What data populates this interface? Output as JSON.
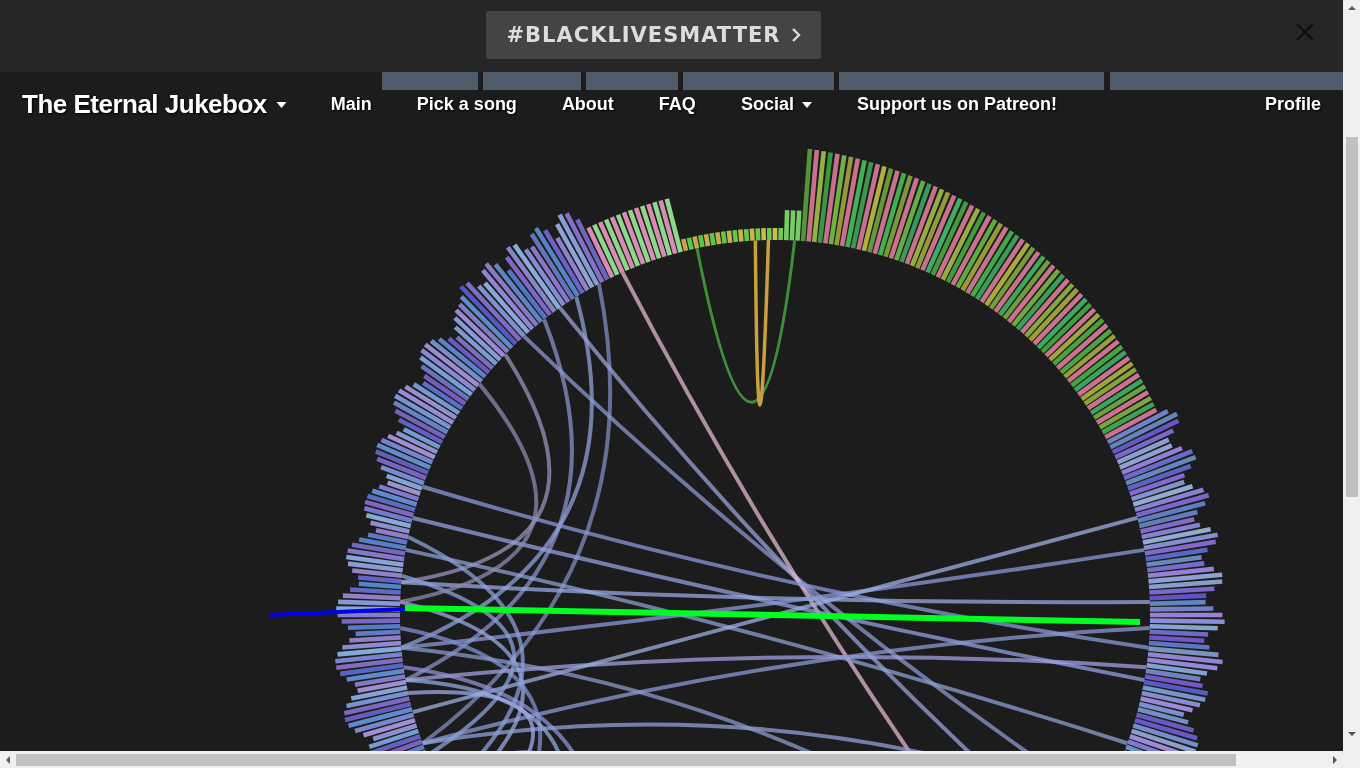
{
  "banner": {
    "label": "#BLACKLIVESMATTER"
  },
  "navbar": {
    "brand": "The Eternal Jukebox",
    "items": [
      {
        "label": "Main",
        "kind": "link"
      },
      {
        "label": "Pick a song",
        "kind": "link"
      },
      {
        "label": "About",
        "kind": "link"
      },
      {
        "label": "FAQ",
        "kind": "link"
      },
      {
        "label": "Social",
        "kind": "dropdown"
      },
      {
        "label": "Support us on Patreon!",
        "kind": "link"
      }
    ],
    "profile": "Profile"
  }
}
